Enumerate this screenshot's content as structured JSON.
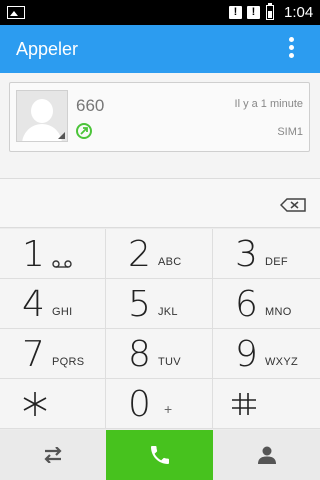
{
  "status_bar": {
    "time": "1:04",
    "alert1": "!",
    "alert2": "!"
  },
  "action_bar": {
    "title": "Appeler"
  },
  "call_log": {
    "number": "660",
    "time": "Il y a 1 minute",
    "sim": "SIM1"
  },
  "dialpad": {
    "keys": [
      {
        "digit": "1",
        "letters": ""
      },
      {
        "digit": "2",
        "letters": "ABC"
      },
      {
        "digit": "3",
        "letters": "DEF"
      },
      {
        "digit": "4",
        "letters": "GHI"
      },
      {
        "digit": "5",
        "letters": "JKL"
      },
      {
        "digit": "6",
        "letters": "MNO"
      },
      {
        "digit": "7",
        "letters": "PQRS"
      },
      {
        "digit": "8",
        "letters": "TUV"
      },
      {
        "digit": "9",
        "letters": "WXYZ"
      },
      {
        "digit": "*",
        "letters": ""
      },
      {
        "digit": "0",
        "letters": "+"
      },
      {
        "digit": "#",
        "letters": ""
      }
    ]
  },
  "colors": {
    "accent": "#2c9cf0",
    "call": "#47c21e"
  }
}
